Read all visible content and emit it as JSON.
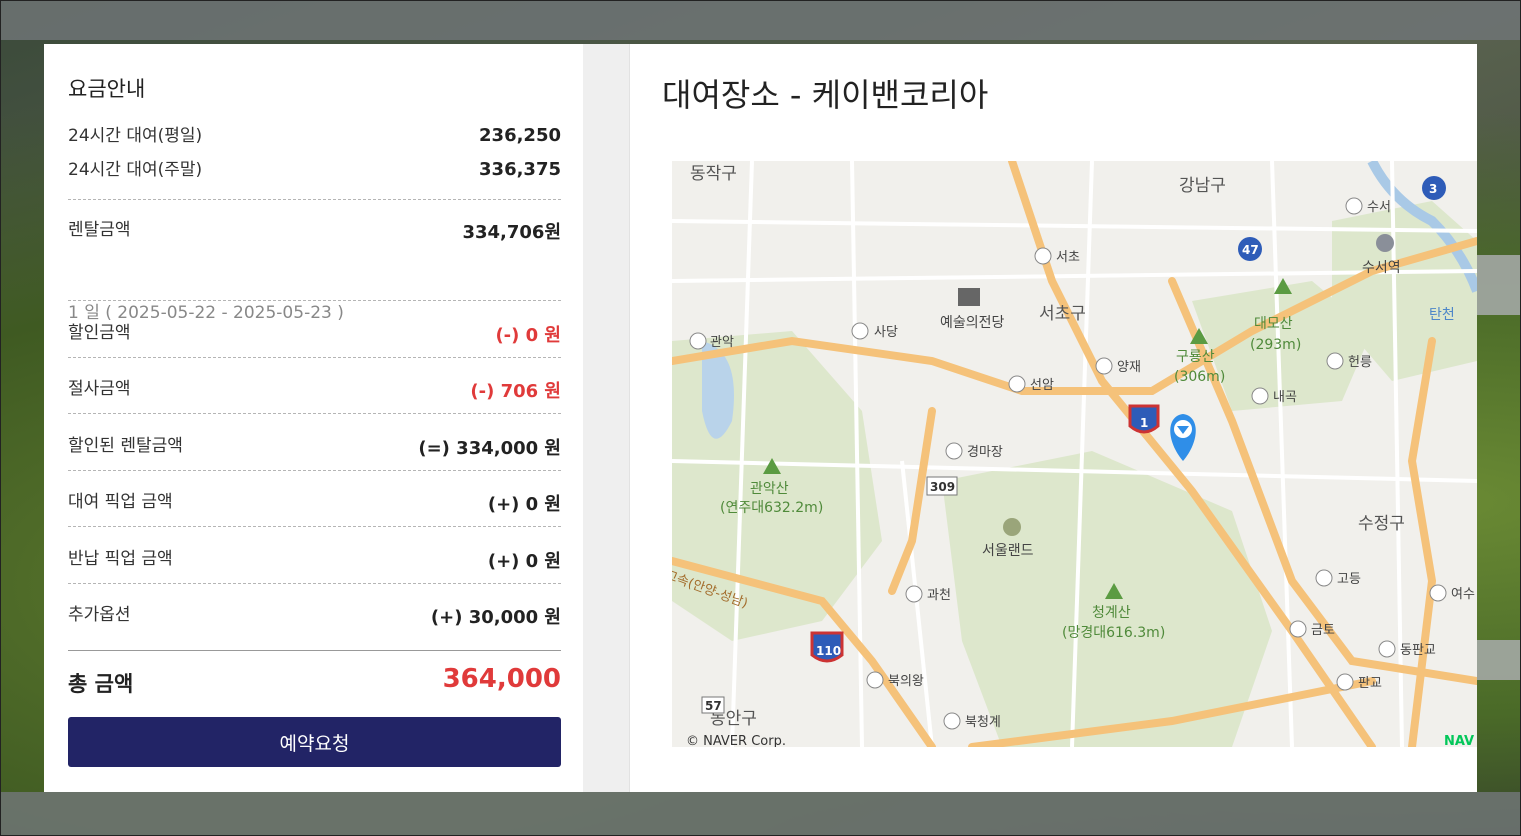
{
  "fee": {
    "title": "요금안내",
    "rates": [
      {
        "label": "24시간 대여(평일)",
        "value": "236,250"
      },
      {
        "label": "24시간 대여(주말)",
        "value": "336,375"
      }
    ],
    "rental": {
      "label": "렌탈금액",
      "value": "334,706원",
      "period": "1 일 ( 2025-05-22 - 2025-05-23 )"
    },
    "lines": [
      {
        "label": "할인금액",
        "value": "(-)  0 원",
        "red": true
      },
      {
        "label": "절사금액",
        "value": "(-)  706 원",
        "red": true
      },
      {
        "label": "할인된 렌탈금액",
        "value": "(=)  334,000 원",
        "red": false
      },
      {
        "label": "대여 픽업 금액",
        "value": "(+)  0 원",
        "red": false
      },
      {
        "label": "반납 픽업 금액",
        "value": "(+)  0 원",
        "red": false
      },
      {
        "label": "추가옵션",
        "value": "(+)  30,000 원",
        "red": false
      }
    ],
    "total": {
      "label": "총 금액",
      "value": "364,000"
    },
    "reserve_button": "예약요청"
  },
  "place": {
    "title": "대여장소 - 케이밴코리아"
  },
  "map": {
    "copyright": "© NAVER Corp.",
    "brand": "NAV",
    "districts": [
      "동작구",
      "강남구",
      "서초구",
      "수정구",
      "동안구"
    ],
    "ic_labels": [
      "서초",
      "사당",
      "관악",
      "선암",
      "양재",
      "경마장",
      "내곡",
      "과천",
      "고등",
      "금토",
      "북의왕",
      "북청계",
      "판교",
      "동판교",
      "헌릉",
      "수서",
      "여수"
    ],
    "landmarks": [
      "예술의전당",
      "서울랜드",
      "수서역",
      "탄천"
    ],
    "mountains": [
      {
        "name": "대모산",
        "height": "(293m)"
      },
      {
        "name": "구룡산",
        "height": "(306m)"
      },
      {
        "name": "관악산",
        "height": "(연주대632.2m)"
      },
      {
        "name": "청계산",
        "height": "(망경대616.3m)"
      }
    ],
    "route_shields": [
      "3",
      "47",
      "1",
      "309",
      "110",
      "57"
    ],
    "road_name": "고속(안양-성남)",
    "colors": {
      "major_road": "#f5c27a",
      "minor_road": "#ffffff",
      "park": "#dfe8cf",
      "pin": "#2f8ee8"
    }
  }
}
